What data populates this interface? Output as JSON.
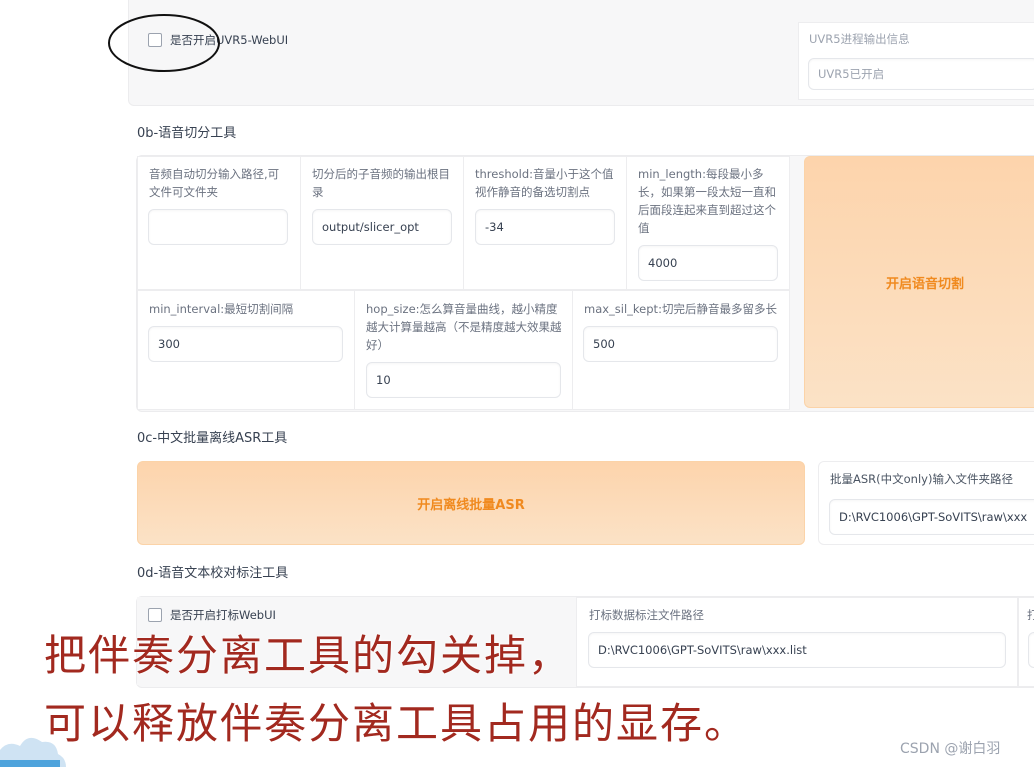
{
  "uvr5": {
    "checkbox_label": "是否开启UVR5-WebUI",
    "info_label": "UVR5进程输出信息",
    "info_value": "UVR5已开启"
  },
  "slicer": {
    "title": "0b-语音切分工具",
    "input_path_label": "音频自动切分输入路径,可文件可文件夹",
    "input_path_value": "",
    "output_dir_label": "切分后的子音频的输出根目录",
    "output_dir_value": "output/slicer_opt",
    "threshold_label": "threshold:音量小于这个值视作静音的备选切割点",
    "threshold_value": "-34",
    "min_length_label": "min_length:每段最小多长，如果第一段太短一直和后面段连起来直到超过这个值",
    "min_length_value": "4000",
    "min_interval_label": "min_interval:最短切割间隔",
    "min_interval_value": "300",
    "hop_size_label": "hop_size:怎么算音量曲线，越小精度越大计算量越高（不是精度越大效果越好）",
    "hop_size_value": "10",
    "max_sil_kept_label": "max_sil_kept:切完后静音最多留多长",
    "max_sil_kept_value": "500",
    "start_button": "开启语音切割"
  },
  "asr": {
    "title": "0c-中文批量离线ASR工具",
    "start_button": "开启离线批量ASR",
    "input_label": "批量ASR(中文only)输入文件夹路径",
    "input_value": "D:\\RVC1006\\GPT-SoVITS\\raw\\xxx"
  },
  "label_tool": {
    "title": "0d-语音文本校对标注工具",
    "checkbox_label": "是否开启打标WebUI",
    "list_path_label": "打标数据标注文件路径",
    "list_path_value": "D:\\RVC1006\\GPT-SoVITS\\raw\\xxx.list",
    "extra_label": "打"
  },
  "overlay": {
    "caption_line1": "把伴奏分离工具的勾关掉，",
    "caption_line2": "可以释放伴奏分离工具占用的显存。",
    "watermark": "CSDN @谢白羽"
  },
  "colors": {
    "accent": "#f08a1f",
    "button_bg": "#fdd4ac",
    "caption": "#a2291f",
    "annotation_circle": "#111111"
  }
}
